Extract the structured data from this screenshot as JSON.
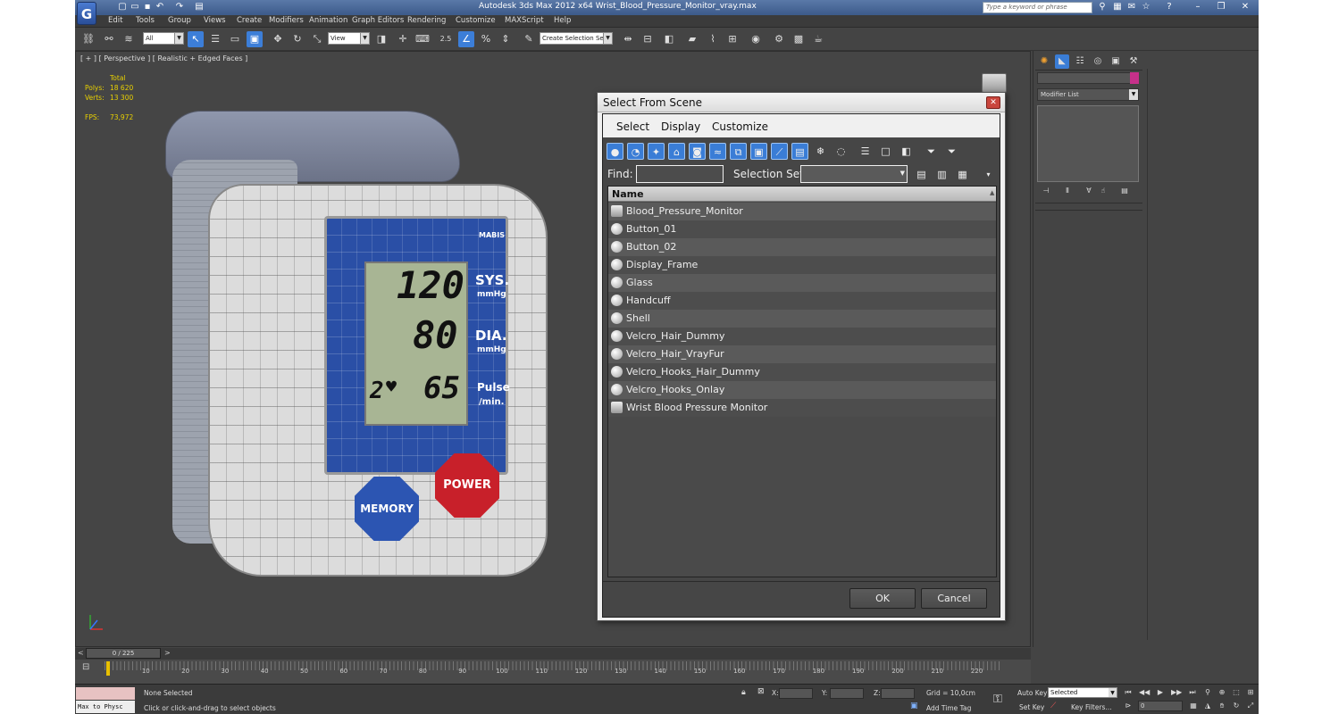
{
  "window": {
    "title": "Autodesk 3ds Max  2012 x64     Wrist_Blood_Pressure_Monitor_vray.max",
    "search_placeholder": "Type a keyword or phrase"
  },
  "menu": [
    "Edit",
    "Tools",
    "Group",
    "Views",
    "Create",
    "Modifiers",
    "Animation",
    "Graph Editors",
    "Rendering",
    "Customize",
    "MAXScript",
    "Help"
  ],
  "toolbar": {
    "filter_dropdown": "All",
    "ref_coord_dropdown": "View",
    "selection_set_dropdown": "Create Selection Se",
    "snap_label": "2.5"
  },
  "viewport": {
    "label": "[ + ] [ Perspective ] [ Realistic + Edged Faces ]",
    "stats": {
      "total_label": "Total",
      "polys_label": "Polys:",
      "polys_value": "18 620",
      "verts_label": "Verts:",
      "verts_value": "13 300",
      "fps_label": "FPS:",
      "fps_value": "73,972"
    },
    "model": {
      "brand": "MABIS",
      "sys_value": "120",
      "dia_value": "80",
      "pulse_value": "65",
      "memory_slot": "2",
      "sys_label": "SYS.",
      "sys_unit": "mmHg",
      "dia_label": "DIA.",
      "dia_unit": "mmHg",
      "pulse_label": "Pulse",
      "pulse_unit": "/min.",
      "memory_button": "MEMORY",
      "power_button": "POWER"
    }
  },
  "command_panel": {
    "modifier_list": "Modifier List",
    "object_color": "#c6308a"
  },
  "timeline": {
    "slider_label": "0 / 225",
    "ticks": [
      "10",
      "20",
      "30",
      "40",
      "50",
      "60",
      "70",
      "80",
      "90",
      "100",
      "110",
      "120",
      "130",
      "140",
      "150",
      "160",
      "170",
      "180",
      "190",
      "200",
      "210",
      "220"
    ]
  },
  "status": {
    "maxscript_label": "Max to Physc",
    "selection_text": "None Selected",
    "prompt_text": "Click or click-and-drag to select objects",
    "x_label": "X:",
    "y_label": "Y:",
    "z_label": "Z:",
    "grid_text": "Grid = 10,0cm",
    "add_time_tag": "Add Time Tag",
    "auto_key": "Auto Key",
    "set_key": "Set Key",
    "key_mode_value": "Selected",
    "key_filters": "Key Filters...",
    "frame_value": "0"
  },
  "dialog": {
    "title": "Select From Scene",
    "menu": [
      "Select",
      "Display",
      "Customize"
    ],
    "find_label": "Find:",
    "selection_set_label": "Selection Set:",
    "column_header": "Name",
    "items": [
      {
        "name": "Blood_Pressure_Monitor",
        "kind": "group"
      },
      {
        "name": "Button_01",
        "kind": "geometry"
      },
      {
        "name": "Button_02",
        "kind": "geometry"
      },
      {
        "name": "Display_Frame",
        "kind": "geometry"
      },
      {
        "name": "Glass",
        "kind": "geometry"
      },
      {
        "name": "Handcuff",
        "kind": "geometry"
      },
      {
        "name": "Shell",
        "kind": "geometry"
      },
      {
        "name": "Velcro_Hair_Dummy",
        "kind": "geometry"
      },
      {
        "name": "Velcro_Hair_VrayFur",
        "kind": "geometry"
      },
      {
        "name": "Velcro_Hooks_Hair_Dummy",
        "kind": "geometry"
      },
      {
        "name": "Velcro_Hooks_Onlay",
        "kind": "geometry"
      },
      {
        "name": "Wrist Blood Pressure Monitor",
        "kind": "group"
      }
    ],
    "ok_label": "OK",
    "cancel_label": "Cancel"
  }
}
